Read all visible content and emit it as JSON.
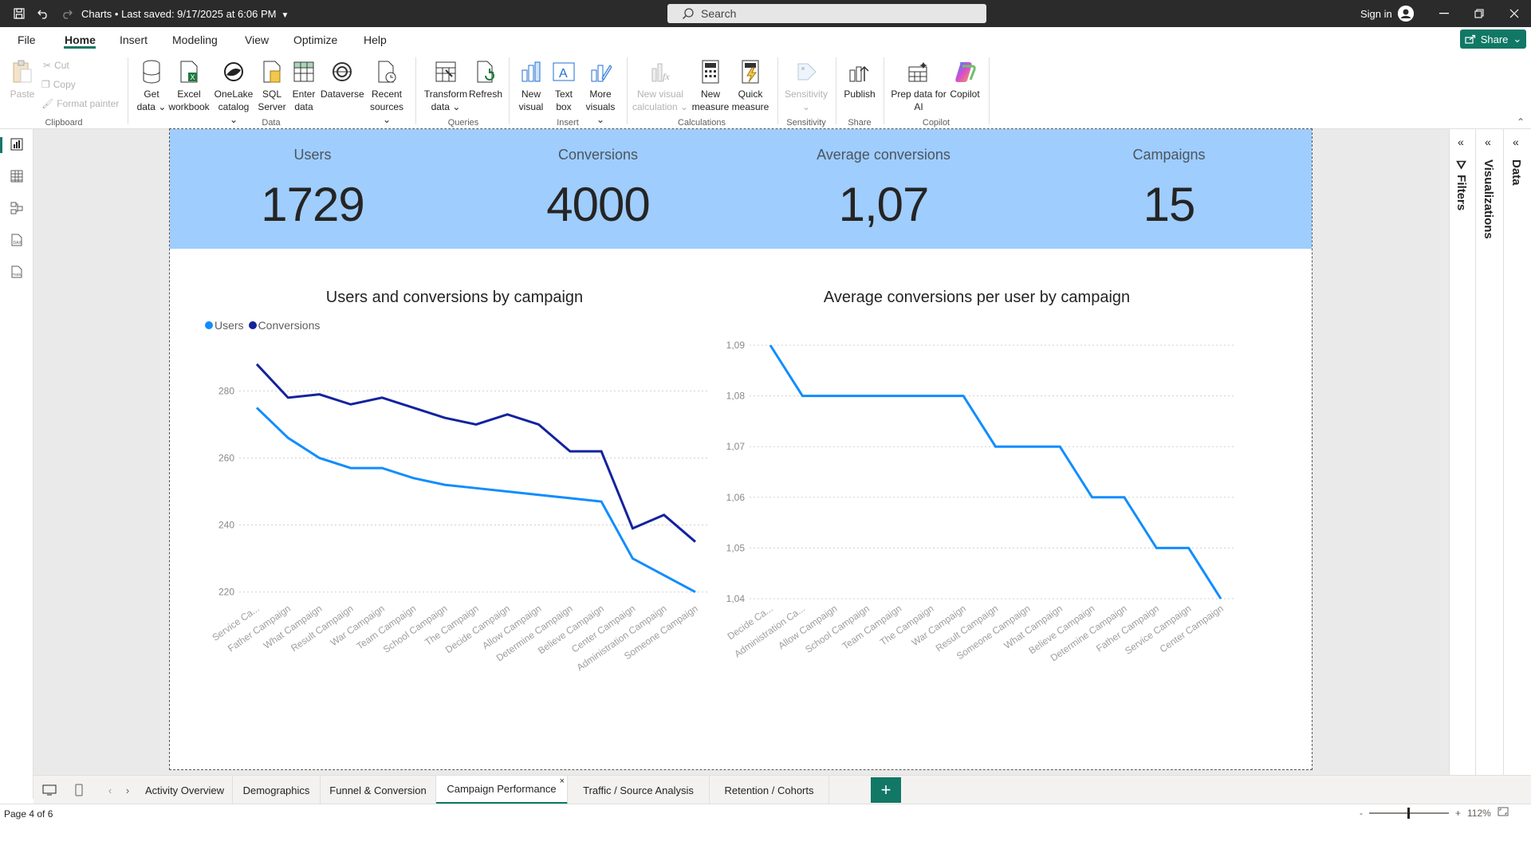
{
  "titlebar": {
    "title": "Charts • Last saved: 9/17/2025 at 6:06 PM",
    "search_placeholder": "Search",
    "sign_in": "Sign in",
    "icons": [
      "save-icon",
      "undo-icon",
      "redo-icon",
      "search-icon",
      "account-icon",
      "minimize-icon",
      "restore-icon",
      "close-icon"
    ]
  },
  "menu": {
    "tabs": [
      "File",
      "Home",
      "Insert",
      "Modeling",
      "View",
      "Optimize",
      "Help"
    ],
    "active": "Home",
    "share": "Share"
  },
  "ribbon": {
    "clipboard": {
      "paste": "Paste",
      "cut": "Cut",
      "copy": "Copy",
      "format_painter": "Format painter",
      "label": "Clipboard"
    },
    "data": {
      "get_data": [
        "Get",
        "data ⌄"
      ],
      "excel": [
        "Excel",
        "workbook"
      ],
      "onelake": [
        "OneLake",
        "catalog ⌄"
      ],
      "sql": [
        "SQL",
        "Server"
      ],
      "enter": [
        "Enter",
        "data"
      ],
      "dataverse": [
        "Dataverse",
        ""
      ],
      "recent": [
        "Recent",
        "sources ⌄"
      ],
      "label": "Data"
    },
    "queries": {
      "transform": [
        "Transform",
        "data ⌄"
      ],
      "refresh": [
        "Refresh",
        ""
      ],
      "label": "Queries"
    },
    "insert": {
      "new_visual": [
        "New",
        "visual"
      ],
      "text_box": [
        "Text",
        "box"
      ],
      "more_visuals": [
        "More",
        "visuals ⌄"
      ],
      "label": "Insert"
    },
    "calculations": {
      "new_visual_calc": [
        "New visual",
        "calculation ⌄"
      ],
      "new_measure": [
        "New",
        "measure"
      ],
      "quick_measure": [
        "Quick",
        "measure"
      ],
      "label": "Calculations"
    },
    "sensitivity": {
      "btn": [
        "Sensitivity",
        "⌄"
      ],
      "label": "Sensitivity"
    },
    "share": {
      "publish": [
        "Publish",
        ""
      ],
      "label": "Share"
    },
    "copilot": {
      "prep": [
        "Prep data for",
        "AI"
      ],
      "copilot": [
        "Copilot",
        ""
      ],
      "label": "Copilot"
    }
  },
  "kpis": [
    {
      "label": "Users",
      "value": "1729"
    },
    {
      "label": "Conversions",
      "value": "4000"
    },
    {
      "label": "Average conversions",
      "value": "1,07"
    },
    {
      "label": "Campaigns",
      "value": "15"
    }
  ],
  "legend": {
    "users": "Users",
    "conversions": "Conversions"
  },
  "colors": {
    "users": "#118dff",
    "conversions": "#12239e",
    "accent": "#117865",
    "kpi_band": "#9fcdfd"
  },
  "chart_data": [
    {
      "type": "line",
      "title": "Users and conversions by campaign",
      "categories": [
        "Service Ca...",
        "Father Campaign",
        "What Campaign",
        "Result Campaign",
        "War Campaign",
        "Team Campaign",
        "School Campaign",
        "The Campaign",
        "Decide Campaign",
        "Allow Campaign",
        "Determine Campaign",
        "Believe Campaign",
        "Center Campaign",
        "Administration Campaign",
        "Someone Campaign"
      ],
      "series": [
        {
          "name": "Users",
          "values": [
            275,
            266,
            260,
            257,
            257,
            254,
            252,
            251,
            250,
            249,
            248,
            247,
            230,
            225,
            220
          ]
        },
        {
          "name": "Conversions",
          "values": [
            288,
            278,
            279,
            276,
            278,
            275,
            272,
            270,
            273,
            270,
            262,
            262,
            239,
            243,
            235
          ]
        }
      ],
      "yticks": [
        220,
        240,
        260,
        280
      ],
      "ylim": [
        218,
        292
      ],
      "legend": "top-left",
      "grid": true
    },
    {
      "type": "line",
      "title": "Average conversions per user by campaign",
      "categories": [
        "Decide Ca...",
        "Administration Ca...",
        "Allow Campaign",
        "School Campaign",
        "Team Campaign",
        "The Campaign",
        "War Campaign",
        "Result Campaign",
        "Someone Campaign",
        "What Campaign",
        "Believe Campaign",
        "Determine Campaign",
        "Father Campaign",
        "Service Campaign",
        "Center Campaign"
      ],
      "series": [
        {
          "values": [
            1.09,
            1.08,
            1.08,
            1.08,
            1.08,
            1.08,
            1.08,
            1.07,
            1.07,
            1.07,
            1.06,
            1.06,
            1.05,
            1.05,
            1.04
          ]
        }
      ],
      "yticks": [
        "1,04",
        "1,05",
        "1,06",
        "1,07",
        "1,08",
        "1,09"
      ],
      "ylim": [
        1.04,
        1.09
      ],
      "grid": true
    }
  ],
  "panes": {
    "filters": "Filters",
    "visualizations": "Visualizations",
    "data": "Data"
  },
  "page_tabs": [
    "Activity Overview",
    "Demographics",
    "Funnel & Conversion",
    "Campaign Performance",
    "Traffic / Source Analysis",
    "Retention / Cohorts"
  ],
  "active_tab": "Campaign Performance",
  "status": {
    "page": "Page 4 of 6",
    "zoom": "112%",
    "zoom_minus": "-",
    "zoom_plus": "+"
  }
}
